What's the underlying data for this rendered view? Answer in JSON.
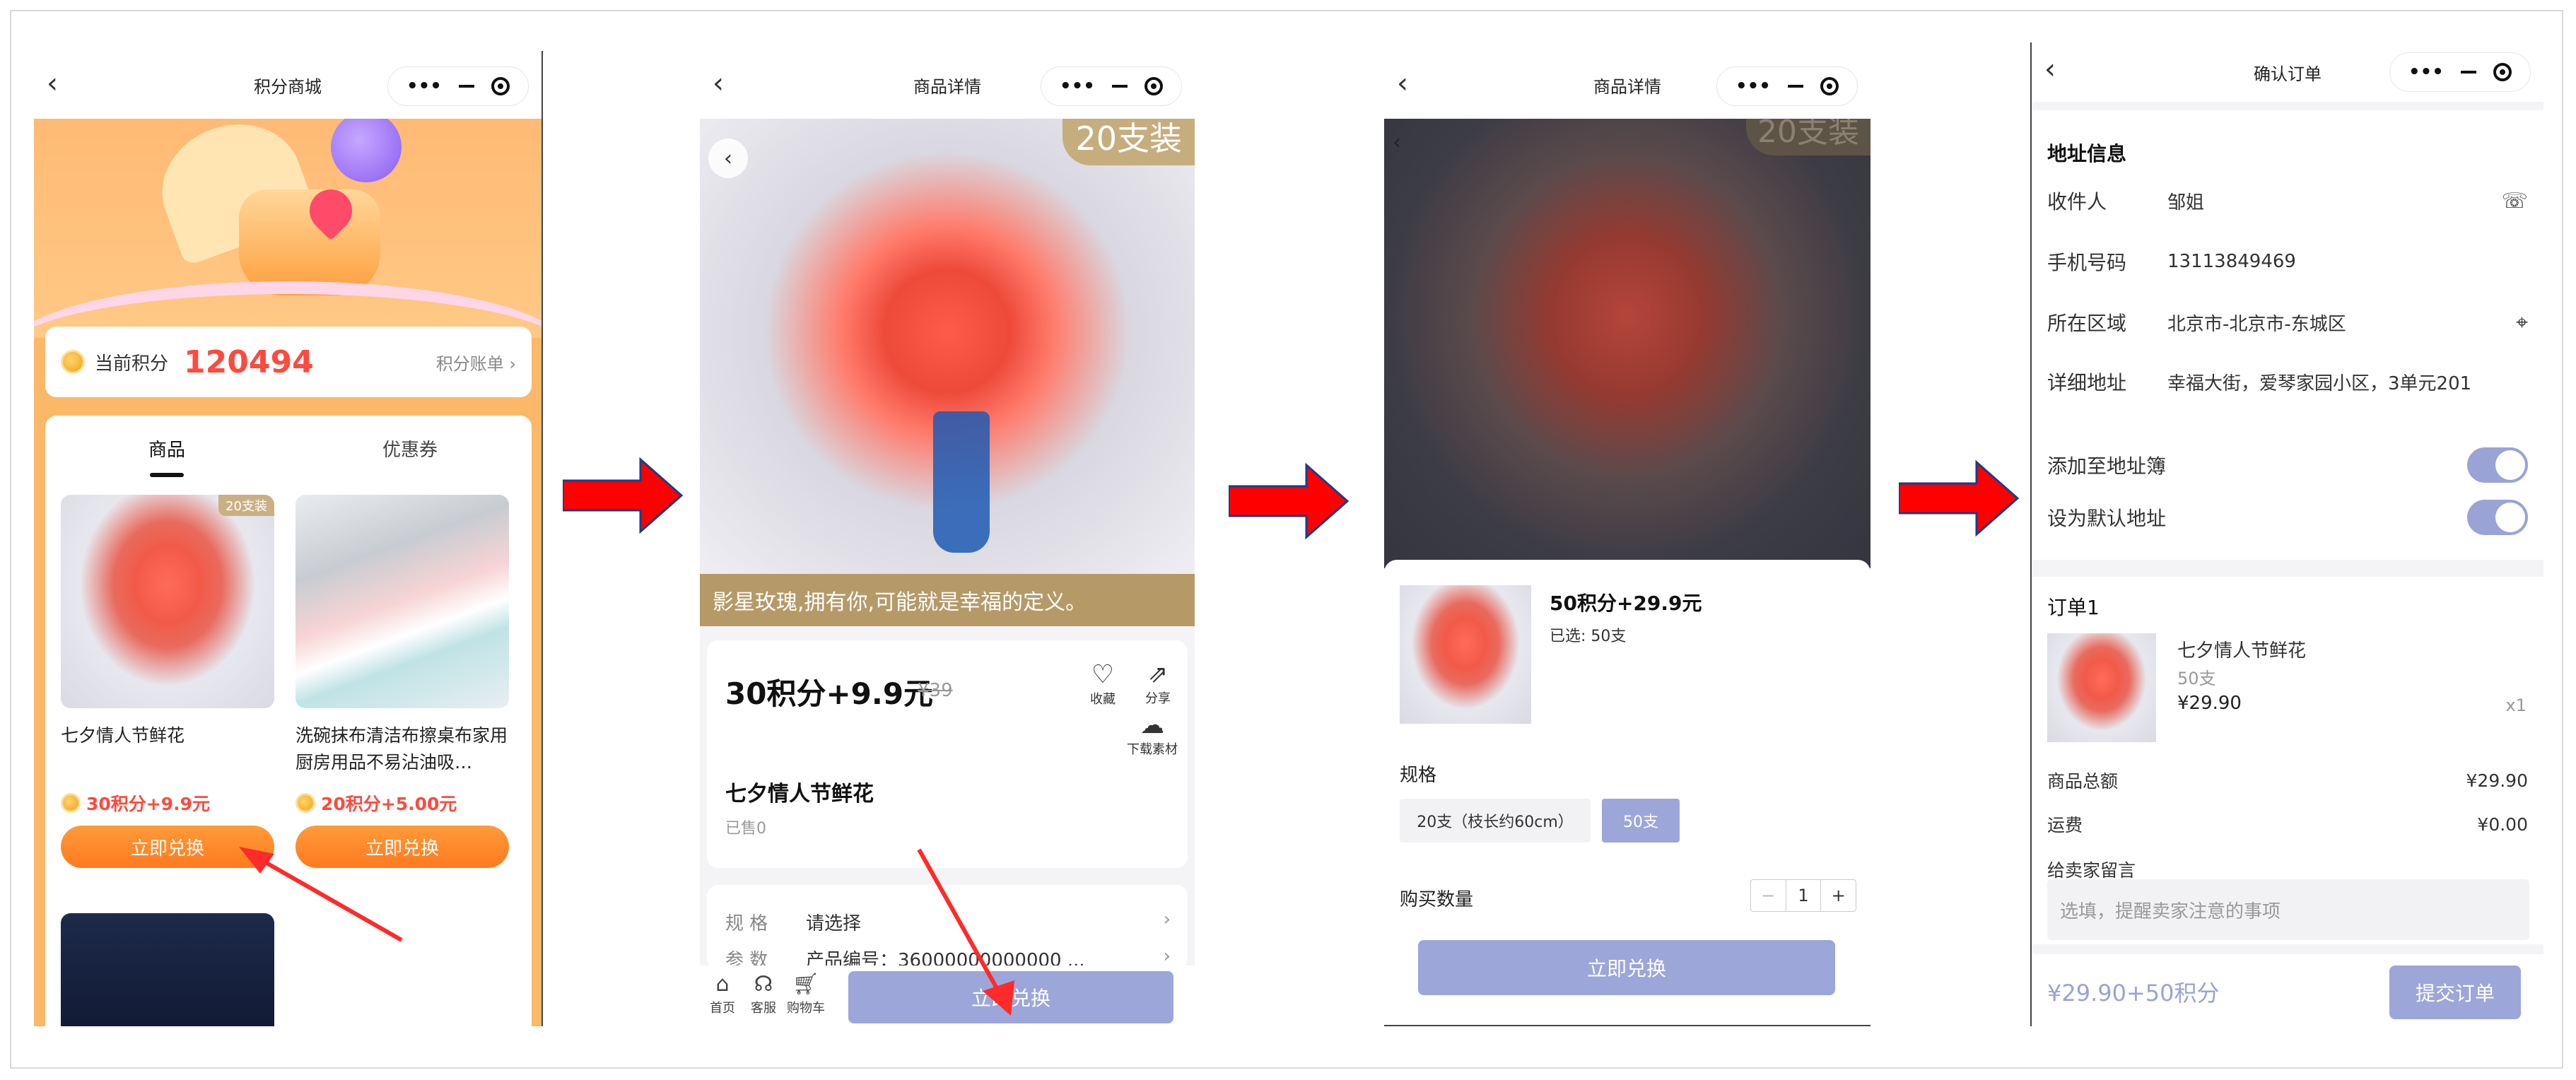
{
  "colors": {
    "accent": "#9da6d8",
    "orange": "#ff8a2a",
    "red_price": "#ff4a3d"
  },
  "screen1": {
    "nav_title": "积分商城",
    "points_label": "当前积分",
    "points_value": "120494",
    "points_link": "积分账单 ›",
    "tabs": [
      "商品",
      "优惠券"
    ],
    "products": [
      {
        "tag": "20支装",
        "name": "七夕情人节鲜花",
        "price": "30积分+9.9元",
        "button": "立即兑换"
      },
      {
        "tag": "",
        "name": "洗碗抹布清洁布擦桌布家用厨房用品不易沾油吸…",
        "price": "20积分+5.00元",
        "button": "立即兑换"
      }
    ]
  },
  "screen2": {
    "nav_title": "商品详情",
    "hero_count": "20支装",
    "hero_caption": "影星玫瑰,拥有你,可能就是幸福的定义。",
    "price": "30积分+9.9元",
    "old_price": "¥39",
    "fav_label": "收藏",
    "share_label": "分享",
    "download_label": "下载素材",
    "title": "七夕情人节鲜花",
    "sold": "已售0",
    "spec_key": "规 格",
    "spec_val": "请选择",
    "param_key": "参 数",
    "param_val": "产品编号：36000000000000 ...",
    "bottom_icons": [
      "首页",
      "客服",
      "购物车"
    ],
    "redeem_button": "立即兑换"
  },
  "screen3": {
    "nav_title": "商品详情",
    "hero_count": "20支装",
    "price": "50积分+29.9元",
    "selected": "已选: 50支",
    "spec_label": "规格",
    "options": [
      "20支（枝长约60cm）",
      "50支"
    ],
    "qty_label": "购买数量",
    "qty_minus": "−",
    "qty_value": "1",
    "qty_plus": "+",
    "redeem_button": "立即兑换"
  },
  "screen4": {
    "nav_title": "确认订单",
    "address_header": "地址信息",
    "fields": [
      {
        "label": "收件人",
        "value": "邹姐"
      },
      {
        "label": "手机号码",
        "value": "13113849469"
      },
      {
        "label": "所在区域",
        "value": "北京市-北京市-东城区"
      },
      {
        "label": "详细地址",
        "value": "幸福大街，爱琴家园小区，3单元201"
      }
    ],
    "toggle_address_book": "添加至地址簿",
    "toggle_default": "设为默认地址",
    "order_header": "订单1",
    "item_name": "七夕情人节鲜花",
    "item_spec": "50支",
    "item_price": "¥29.90",
    "item_qty": "x1",
    "subtotal_label": "商品总额",
    "subtotal_value": "¥29.90",
    "shipping_label": "运费",
    "shipping_value": "¥0.00",
    "note_label": "给卖家留言",
    "note_placeholder": "选填，提醒卖家注意的事项",
    "total": "¥29.90+50积分",
    "submit_button": "提交订单"
  }
}
